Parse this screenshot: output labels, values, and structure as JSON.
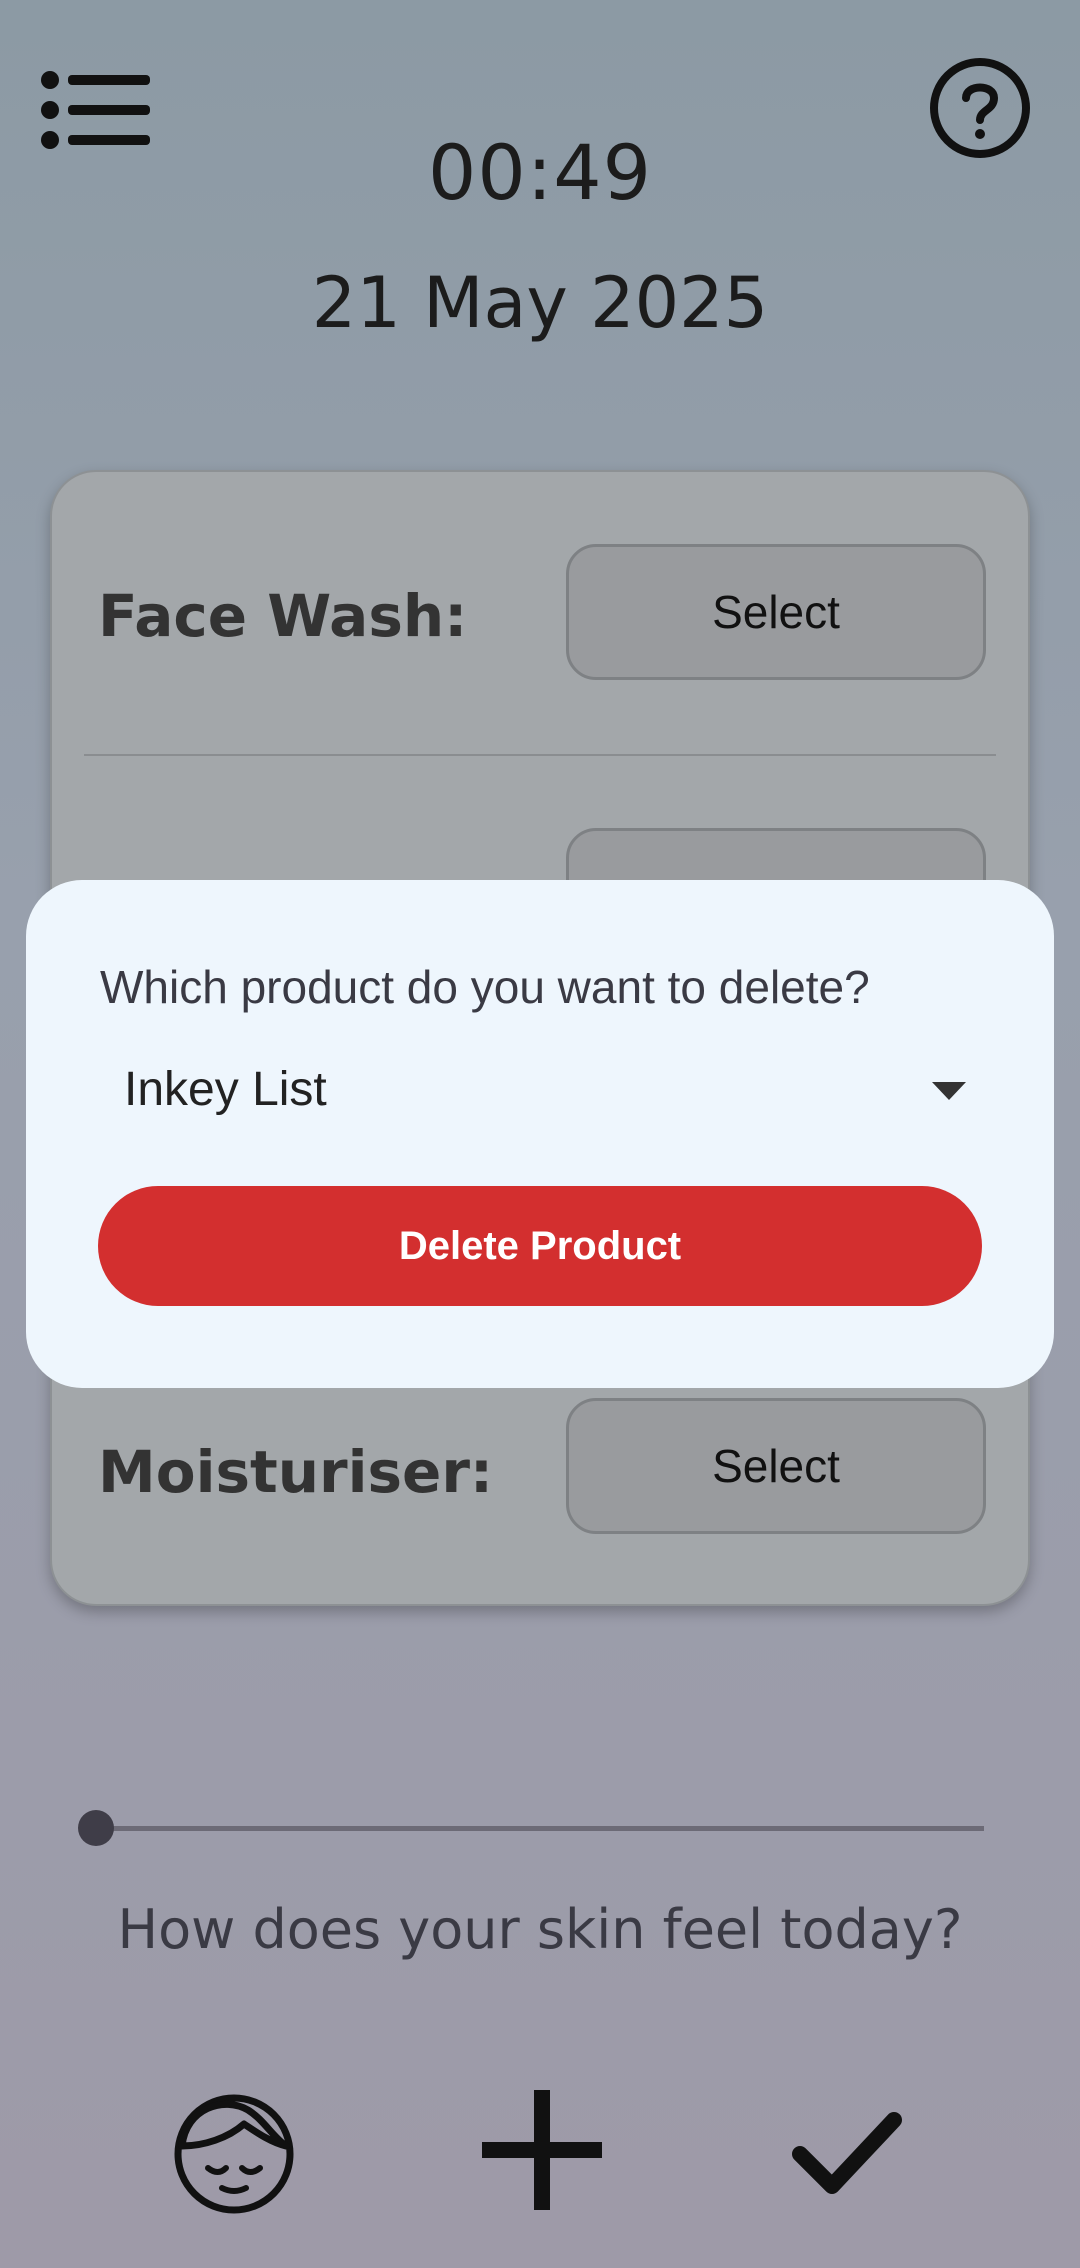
{
  "header": {
    "time": "00:49",
    "date": "21 May 2025",
    "menu_icon": "list-icon",
    "help_icon": "help-circle-icon"
  },
  "routine": {
    "rows": [
      {
        "label": "Face Wash:",
        "button_label": "Select"
      },
      {
        "label": "Moisturiser:",
        "button_label": "Select"
      }
    ]
  },
  "dialog": {
    "question": "Which product do you want to delete?",
    "selected_product": "Inkey List",
    "delete_label": "Delete Product",
    "delete_color": "#d32f2f"
  },
  "skin": {
    "question": "How does your skin feel today?",
    "slider_value": 0
  },
  "bottom_nav": {
    "items": [
      {
        "icon": "face-icon"
      },
      {
        "icon": "plus-icon"
      },
      {
        "icon": "check-icon"
      }
    ]
  }
}
